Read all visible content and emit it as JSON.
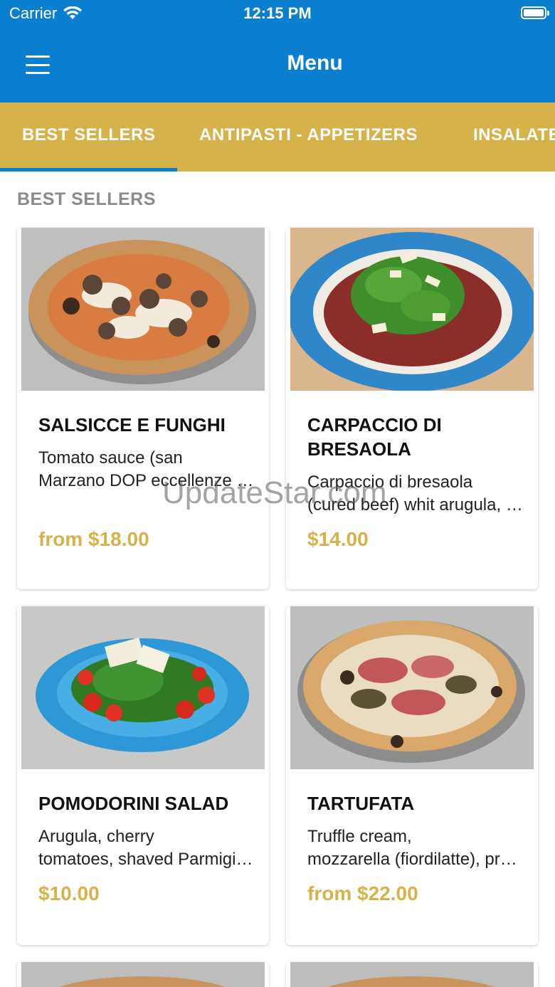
{
  "status_bar": {
    "carrier": "Carrier",
    "time": "12:15 PM"
  },
  "nav": {
    "title": "Menu"
  },
  "tabs": [
    {
      "label": "BEST SELLERS",
      "selected": true
    },
    {
      "label": "ANTIPASTI - APPETIZERS",
      "selected": false
    },
    {
      "label": "INSALATE",
      "selected": false
    }
  ],
  "section": {
    "heading": "BEST SELLERS"
  },
  "items": [
    {
      "title": "SALSICCE E FUNGHI",
      "desc_line1": "Tomato sauce (san",
      "desc_line2": "Marzano DOP eccellenze campane), mozzarella",
      "price": "from $18.00"
    },
    {
      "title": "CARPACCIO DI BRESAOLA",
      "desc_line1": "Carpaccio di bresaola",
      "desc_line2": "(cured beef) whit arugula, shaved parmigiano",
      "price": "$14.00"
    },
    {
      "title": "POMODORINI SALAD",
      "desc_line1": "Arugula, cherry",
      "desc_line2": "tomatoes, shaved Parmigiano Reggiano",
      "price": "$10.00"
    },
    {
      "title": "TARTUFATA",
      "desc_line1": "Truffle cream,",
      "desc_line2": "mozzarella (fiordilatte), prosciutto crudo",
      "price": "from $22.00"
    }
  ],
  "watermark": "UpdateStar.com",
  "colors": {
    "primary_blue": "#0A7FCF",
    "gold": "#D6B24A",
    "heading_gray": "#8B8B8B"
  }
}
